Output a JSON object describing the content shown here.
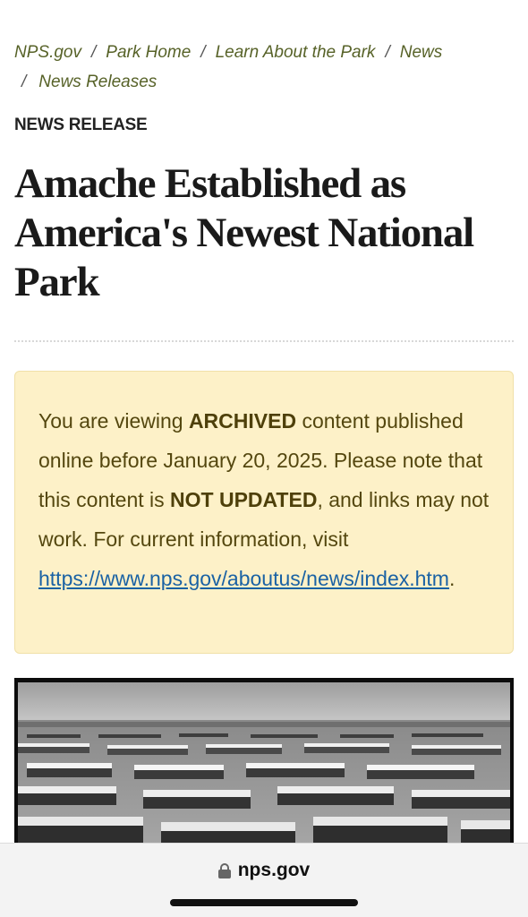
{
  "breadcrumb": {
    "items": [
      "NPS.gov",
      "Park Home",
      "Learn About the Park",
      "News",
      "News Releases"
    ],
    "separator": "/"
  },
  "kicker": "NEWS RELEASE",
  "article": {
    "title": "Amache Established as America's Newest National Park"
  },
  "archive_notice": {
    "t1": "You are viewing ",
    "b1": "ARCHIVED",
    "t2": " content published online before January 20, 2025. Please note that this content is ",
    "b2": "NOT UPDATED",
    "t3": ", and links may not work. For current information, visit ",
    "link": "https://www.nps.gov/aboutus/news/index.htm",
    "t4": "."
  },
  "photo": {
    "description_icon": "historic-photo"
  },
  "browser": {
    "url": "nps.gov",
    "lock_icon": "lock-icon"
  },
  "colors": {
    "breadcrumb": "#576228",
    "notice_bg": "#fdf1c8",
    "notice_text": "#54470f",
    "link": "#1a62a4"
  }
}
